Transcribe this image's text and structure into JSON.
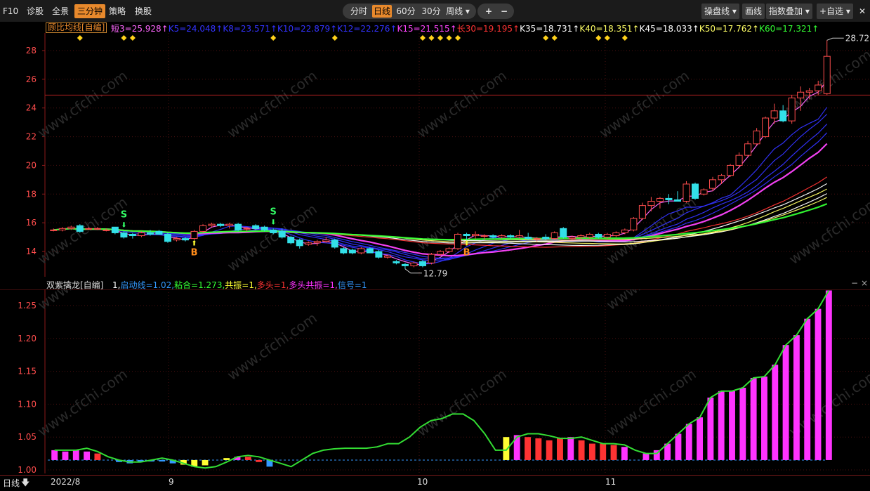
{
  "toolbar": {
    "left_items": [
      "F10",
      "诊股",
      "全景",
      "三分钟",
      "策略",
      "换股"
    ],
    "active_left": "三分钟",
    "periods": [
      "分时",
      "日线",
      "60分",
      "30分",
      "周线 ▾"
    ],
    "active_period": "日线",
    "zoom_in": "+",
    "zoom_out": "−",
    "right_items": [
      "操盘线 ▾",
      "画线",
      "指数叠加 ▾",
      "+自选 ▾"
    ],
    "close_symbol": "✕"
  },
  "main_indicator": {
    "name": "顾比均线[自编]",
    "values": [
      {
        "text": "短3=25.928↑",
        "color": "#ff66ff"
      },
      {
        "text": "K5=24.048↑",
        "color": "#3333ff"
      },
      {
        "text": "K8=23.571↑",
        "color": "#3333ff"
      },
      {
        "text": "K10=22.879↑",
        "color": "#3333ff"
      },
      {
        "text": "K12=22.276↑",
        "color": "#3333ff"
      },
      {
        "text": "K15=21.515↑",
        "color": "#ff44ff"
      },
      {
        "text": "长30=19.195↑",
        "color": "#ff3333"
      },
      {
        "text": "K35=18.731↑",
        "color": "#ffffff"
      },
      {
        "text": "K40=18.351↑",
        "color": "#ffff66"
      },
      {
        "text": "K45=18.033↑",
        "color": "#ffffff"
      },
      {
        "text": "K50=17.762↑",
        "color": "#ffff66"
      },
      {
        "text": "K60=17.321↑",
        "color": "#33ff33"
      }
    ]
  },
  "price_axis": {
    "labels": [
      "28",
      "26",
      "24",
      "22",
      "20",
      "18",
      "16",
      "14"
    ],
    "color": "#ff3333"
  },
  "annotations": {
    "high_label": "28.72",
    "low_label": "12.79",
    "buy_marker": "B",
    "sell_marker": "S"
  },
  "sub_indicator": {
    "name": "双紫擒龙[自编]",
    "values": [
      {
        "text": "1,",
        "color": "#ffffff"
      },
      {
        "text": "启动线=1.02,",
        "color": "#3399ff"
      },
      {
        "text": "粘合=1.273,",
        "color": "#33ff33"
      },
      {
        "text": "共振=1,",
        "color": "#ffff33"
      },
      {
        "text": "多头=1,",
        "color": "#ff3333"
      },
      {
        "text": "多头共振=1,",
        "color": "#ff33ff"
      },
      {
        "text": "信号=1",
        "color": "#3399ff"
      }
    ]
  },
  "sub_axis": {
    "labels": [
      "1.25",
      "1.20",
      "1.15",
      "1.10",
      "1.05",
      "1.00"
    ]
  },
  "date_axis": {
    "period_label": "日线",
    "labels": [
      "2022/8",
      "9",
      "10",
      "11"
    ]
  },
  "watermark": "www.cfchi.com",
  "colors": {
    "up": "#ff4d4d",
    "down": "#33e0e8",
    "accent": "#e8892c",
    "neg_axis": "#ff3333"
  },
  "chart_data": [
    {
      "type": "candlestick",
      "title": "顾比均线[自编]",
      "ylim": [
        13,
        29
      ],
      "x_labels": [
        "2022/8",
        "9",
        "10",
        "11"
      ],
      "y_ticks": [
        14,
        16,
        18,
        20,
        22,
        24,
        26,
        28
      ],
      "annotations": {
        "max": 28.72,
        "min": 12.79
      },
      "candles_ohlc": [
        [
          15.5,
          15.6,
          15.4,
          15.5
        ],
        [
          15.5,
          15.7,
          15.4,
          15.6
        ],
        [
          15.6,
          15.8,
          15.5,
          15.7
        ],
        [
          15.8,
          15.9,
          15.3,
          15.4
        ],
        [
          15.6,
          15.7,
          15.5,
          15.6
        ],
        [
          15.6,
          15.7,
          15.5,
          15.6
        ],
        [
          15.5,
          15.6,
          15.4,
          15.5
        ],
        [
          15.7,
          15.7,
          15.2,
          15.3
        ],
        [
          15.3,
          15.4,
          14.9,
          15.0
        ],
        [
          15.2,
          15.3,
          14.9,
          15.1
        ],
        [
          15.1,
          15.4,
          15.0,
          15.3
        ],
        [
          15.3,
          15.5,
          15.1,
          15.2
        ],
        [
          15.4,
          15.5,
          15.2,
          15.2
        ],
        [
          15.2,
          15.3,
          14.6,
          14.7
        ],
        [
          14.8,
          15.0,
          14.7,
          14.9
        ],
        [
          14.9,
          15.0,
          14.7,
          14.8
        ],
        [
          14.9,
          15.5,
          14.8,
          15.4
        ],
        [
          15.4,
          15.9,
          15.3,
          15.8
        ],
        [
          15.8,
          16.0,
          15.7,
          15.9
        ],
        [
          15.9,
          16.0,
          15.7,
          15.8
        ],
        [
          15.8,
          16.0,
          15.6,
          15.9
        ],
        [
          15.9,
          16.0,
          15.4,
          15.5
        ],
        [
          15.6,
          15.7,
          15.4,
          15.6
        ],
        [
          15.8,
          15.9,
          15.5,
          15.6
        ],
        [
          15.7,
          15.8,
          15.4,
          15.5
        ],
        [
          15.5,
          15.6,
          15.2,
          15.3
        ],
        [
          15.4,
          15.6,
          14.9,
          15.0
        ],
        [
          15.0,
          15.1,
          14.5,
          14.6
        ],
        [
          14.8,
          14.9,
          14.2,
          14.4
        ],
        [
          14.5,
          14.7,
          14.4,
          14.6
        ],
        [
          14.6,
          14.8,
          14.4,
          14.7
        ],
        [
          14.7,
          15.0,
          14.6,
          14.8
        ],
        [
          14.8,
          14.9,
          14.2,
          14.3
        ],
        [
          14.2,
          14.3,
          13.8,
          13.9
        ],
        [
          14.1,
          14.2,
          13.8,
          13.9
        ],
        [
          13.9,
          14.3,
          13.8,
          14.2
        ],
        [
          14.2,
          14.3,
          13.9,
          13.9
        ],
        [
          14.0,
          14.1,
          13.5,
          13.6
        ],
        [
          13.6,
          13.8,
          13.5,
          13.7
        ],
        [
          13.3,
          13.4,
          13.1,
          13.2
        ],
        [
          13.1,
          13.2,
          12.79,
          13.0
        ],
        [
          13.0,
          13.3,
          12.9,
          13.2
        ],
        [
          13.3,
          13.4,
          12.9,
          13.0
        ],
        [
          13.2,
          13.9,
          13.1,
          13.8
        ],
        [
          13.8,
          14.1,
          13.7,
          14.0
        ],
        [
          14.0,
          14.3,
          13.9,
          14.2
        ],
        [
          14.2,
          15.3,
          14.1,
          15.2
        ],
        [
          15.2,
          15.3,
          14.8,
          15.1
        ],
        [
          15.1,
          15.4,
          14.9,
          15.2
        ],
        [
          15.1,
          15.2,
          14.8,
          15.1
        ],
        [
          15.1,
          15.2,
          14.9,
          15.0
        ],
        [
          15.0,
          15.2,
          14.9,
          15.1
        ],
        [
          15.1,
          15.2,
          14.9,
          15.0
        ],
        [
          15.0,
          15.5,
          14.9,
          15.1
        ],
        [
          15.0,
          15.3,
          14.8,
          14.9
        ],
        [
          14.9,
          15.0,
          14.7,
          14.9
        ],
        [
          15.0,
          15.2,
          14.8,
          14.9
        ],
        [
          14.9,
          15.4,
          14.8,
          15.3
        ],
        [
          15.6,
          15.7,
          14.9,
          15.0
        ],
        [
          14.9,
          15.1,
          14.8,
          15.0
        ],
        [
          15.0,
          15.2,
          14.8,
          15.1
        ],
        [
          15.0,
          15.3,
          14.9,
          15.2
        ],
        [
          15.2,
          15.3,
          14.9,
          15.0
        ],
        [
          15.0,
          15.3,
          14.9,
          15.2
        ],
        [
          15.1,
          15.4,
          15.0,
          15.3
        ],
        [
          15.3,
          15.6,
          15.2,
          15.5
        ],
        [
          15.5,
          16.4,
          15.4,
          16.3
        ],
        [
          16.3,
          17.4,
          16.2,
          17.2
        ],
        [
          17.2,
          17.8,
          16.8,
          17.5
        ],
        [
          17.5,
          17.8,
          17.0,
          17.7
        ],
        [
          17.7,
          18.0,
          17.3,
          17.6
        ],
        [
          17.6,
          18.2,
          17.5,
          17.5
        ],
        [
          17.5,
          18.9,
          17.4,
          18.7
        ],
        [
          18.7,
          18.8,
          17.6,
          17.7
        ],
        [
          18.0,
          18.4,
          17.9,
          18.3
        ],
        [
          18.4,
          19.2,
          18.2,
          19.0
        ],
        [
          19.0,
          19.4,
          18.7,
          19.3
        ],
        [
          19.3,
          20.1,
          19.2,
          20.0
        ],
        [
          20.0,
          20.9,
          19.8,
          20.7
        ],
        [
          20.7,
          21.7,
          20.6,
          21.5
        ],
        [
          21.5,
          22.6,
          21.4,
          22.4
        ],
        [
          22.0,
          23.4,
          21.9,
          23.3
        ],
        [
          23.3,
          24.3,
          22.9,
          23.8
        ],
        [
          23.8,
          24.2,
          23.0,
          23.1
        ],
        [
          23.1,
          24.9,
          22.9,
          24.7
        ],
        [
          24.7,
          25.5,
          23.8,
          25.1
        ],
        [
          25.1,
          25.4,
          24.6,
          25.2
        ],
        [
          25.2,
          25.9,
          24.9,
          25.6
        ],
        [
          25.0,
          28.72,
          24.9,
          27.6
        ]
      ],
      "moving_averages": [
        {
          "name": "短3",
          "color": "#ff66ff",
          "last": 25.928
        },
        {
          "name": "K5",
          "color": "#3333ff",
          "last": 24.048
        },
        {
          "name": "K8",
          "color": "#3333ff",
          "last": 23.571
        },
        {
          "name": "K10",
          "color": "#3333ff",
          "last": 22.879
        },
        {
          "name": "K12",
          "color": "#3333ff",
          "last": 22.276
        },
        {
          "name": "K15",
          "color": "#ff44ff",
          "last": 21.515
        },
        {
          "name": "长30",
          "color": "#ff3333",
          "last": 19.195
        },
        {
          "name": "K35",
          "color": "#ffffff",
          "last": 18.731
        },
        {
          "name": "K40",
          "color": "#ffff66",
          "last": 18.351
        },
        {
          "name": "K45",
          "color": "#ffffff",
          "last": 18.033
        },
        {
          "name": "K50",
          "color": "#ffff66",
          "last": 17.762
        },
        {
          "name": "K60",
          "color": "#33ff33",
          "last": 17.321
        }
      ],
      "signal_markers": [
        {
          "label": "S",
          "index": 8
        },
        {
          "label": "B",
          "index": 16
        },
        {
          "label": "S",
          "index": 25
        },
        {
          "label": "B",
          "index": 47
        }
      ],
      "diamond_indices": [
        3,
        8,
        9,
        25,
        32,
        42,
        43,
        44,
        45,
        46,
        56,
        57,
        62,
        63,
        65
      ]
    },
    {
      "type": "bar",
      "title": "双紫擒龙[自编]",
      "ylim": [
        0.995,
        1.275
      ],
      "y_ticks": [
        1.0,
        1.05,
        1.1,
        1.15,
        1.2,
        1.25
      ],
      "reference_line": 1.015,
      "line_values": [
        1.03,
        1.03,
        1.03,
        1.033,
        1.028,
        1.02,
        1.015,
        1.012,
        1.012,
        1.015,
        1.018,
        1.015,
        1.01,
        1.005,
        1.003,
        1.005,
        1.012,
        1.02,
        1.022,
        1.02,
        1.015,
        1.01,
        1.005,
        1.015,
        1.025,
        1.03,
        1.032,
        1.033,
        1.033,
        1.033,
        1.035,
        1.04,
        1.04,
        1.05,
        1.065,
        1.075,
        1.078,
        1.085,
        1.085,
        1.075,
        1.055,
        1.03,
        1.03,
        1.05,
        1.055,
        1.055,
        1.052,
        1.048,
        1.048,
        1.05,
        1.045,
        1.04,
        1.04,
        1.038,
        1.03,
        1.025,
        1.025,
        1.04,
        1.055,
        1.07,
        1.08,
        1.11,
        1.12,
        1.12,
        1.125,
        1.14,
        1.142,
        1.16,
        1.19,
        1.205,
        1.23,
        1.245,
        1.273
      ],
      "bars": [
        [
          0,
          1.03,
          "#ff33ff"
        ],
        [
          1,
          1.028,
          "#ff33ff"
        ],
        [
          2,
          1.03,
          "#ff33ff"
        ],
        [
          3,
          1.028,
          "#ff33ff"
        ],
        [
          4,
          1.025,
          "#ff3333"
        ],
        [
          6,
          1.012,
          "#3399ff"
        ],
        [
          7,
          1.01,
          "#3399ff"
        ],
        [
          8,
          1.012,
          "#3399ff"
        ],
        [
          9,
          1.013,
          "#3399ff"
        ],
        [
          10,
          1.013,
          "#3399ff"
        ],
        [
          11,
          1.01,
          "#3399ff"
        ],
        [
          12,
          1.008,
          "#ffff33"
        ],
        [
          13,
          1.005,
          "#ffff33"
        ],
        [
          14,
          1.007,
          "#ffff33"
        ],
        [
          16,
          1.018,
          "#ffff33"
        ],
        [
          17,
          1.02,
          "#ff33ff"
        ],
        [
          18,
          1.02,
          "#ff3333"
        ],
        [
          19,
          1.012,
          "#ff3333"
        ],
        [
          20,
          1.005,
          "#3399ff"
        ],
        [
          42,
          1.05,
          "#ffff33"
        ],
        [
          43,
          1.053,
          "#ff33ff"
        ],
        [
          44,
          1.05,
          "#ff3333"
        ],
        [
          45,
          1.048,
          "#ff3333"
        ],
        [
          46,
          1.045,
          "#ff3333"
        ],
        [
          47,
          1.048,
          "#ff3333"
        ],
        [
          48,
          1.05,
          "#ff33ff"
        ],
        [
          49,
          1.045,
          "#ff3333"
        ],
        [
          50,
          1.04,
          "#ff3333"
        ],
        [
          51,
          1.04,
          "#ff3333"
        ],
        [
          52,
          1.038,
          "#ff3333"
        ],
        [
          53,
          1.035,
          "#ff33ff"
        ],
        [
          55,
          1.025,
          "#ff33ff"
        ],
        [
          56,
          1.03,
          "#ff33ff"
        ],
        [
          57,
          1.04,
          "#ff33ff"
        ],
        [
          58,
          1.055,
          "#ff33ff"
        ],
        [
          59,
          1.07,
          "#ff33ff"
        ],
        [
          60,
          1.08,
          "#ff33ff"
        ],
        [
          61,
          1.11,
          "#ff33ff"
        ],
        [
          62,
          1.12,
          "#ff33ff"
        ],
        [
          63,
          1.12,
          "#ff33ff"
        ],
        [
          64,
          1.125,
          "#ff33ff"
        ],
        [
          65,
          1.14,
          "#ff33ff"
        ],
        [
          66,
          1.142,
          "#ff33ff"
        ],
        [
          67,
          1.16,
          "#ff33ff"
        ],
        [
          68,
          1.19,
          "#ff33ff"
        ],
        [
          69,
          1.205,
          "#ff33ff"
        ],
        [
          70,
          1.23,
          "#ff33ff"
        ],
        [
          71,
          1.245,
          "#ff33ff"
        ],
        [
          72,
          1.273,
          "#ff33ff"
        ]
      ]
    }
  ]
}
